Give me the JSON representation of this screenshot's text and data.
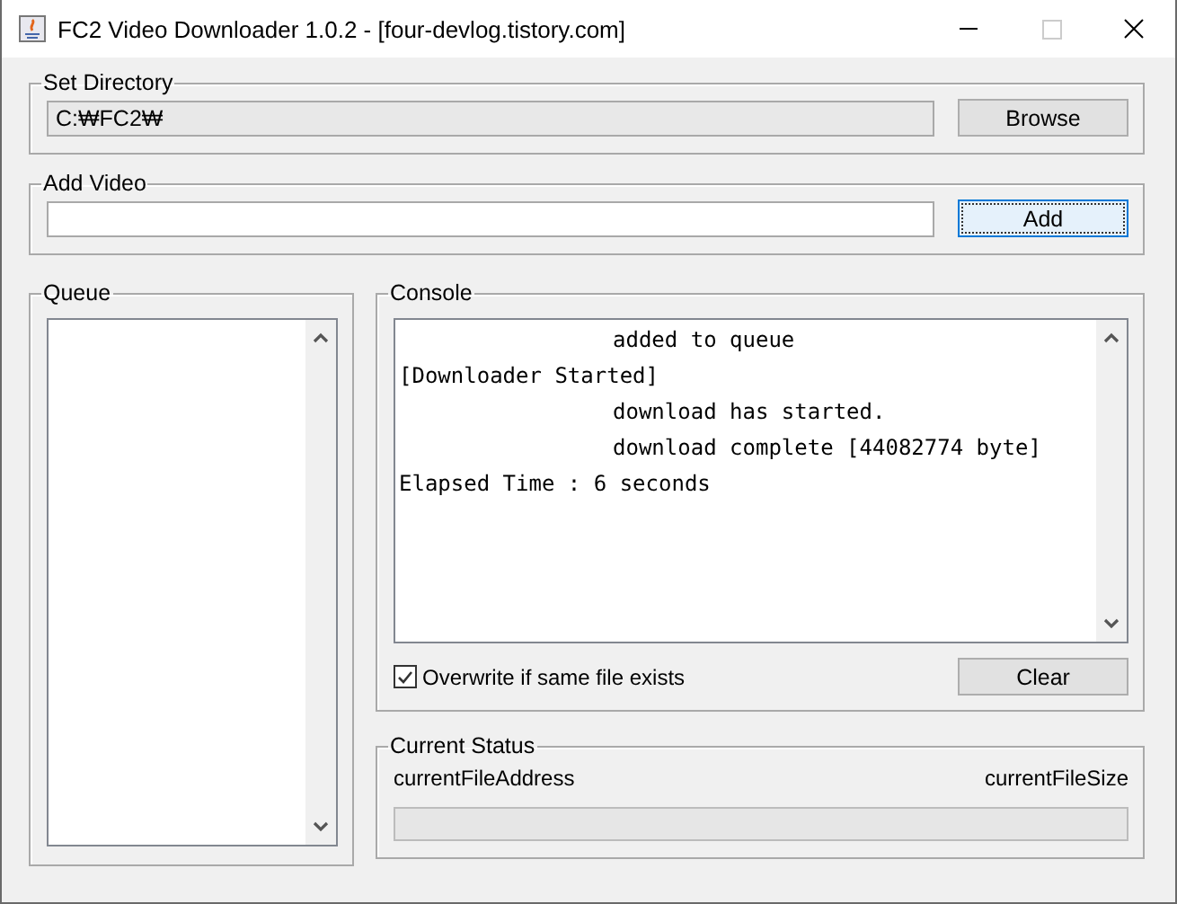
{
  "window": {
    "title": "FC2 Video Downloader 1.0.2 - [four-devlog.tistory.com]"
  },
  "set_directory": {
    "title": "Set Directory",
    "value": "C:₩FC2₩",
    "button": "Browse"
  },
  "add_video": {
    "title": "Add Video",
    "button": "Add",
    "button_focused": true
  },
  "queue": {
    "title": "Queue"
  },
  "console": {
    "title": "Console",
    "lines": [
      {
        "text": "added to queue",
        "indented": true
      },
      {
        "text": "[Downloader Started]",
        "indented": false
      },
      {
        "text": "download has started.",
        "indented": true
      },
      {
        "text": "download complete [44082774 byte]",
        "indented": true
      },
      {
        "text": "Elapsed Time : 6 seconds",
        "indented": false
      }
    ],
    "overwrite": {
      "label": "Overwrite if same file exists",
      "checked": true
    },
    "clear_button": "Clear"
  },
  "current_status": {
    "title": "Current Status",
    "file_address": "currentFileAddress",
    "file_size": "currentFileSize",
    "progress": {
      "level": 0
    }
  }
}
